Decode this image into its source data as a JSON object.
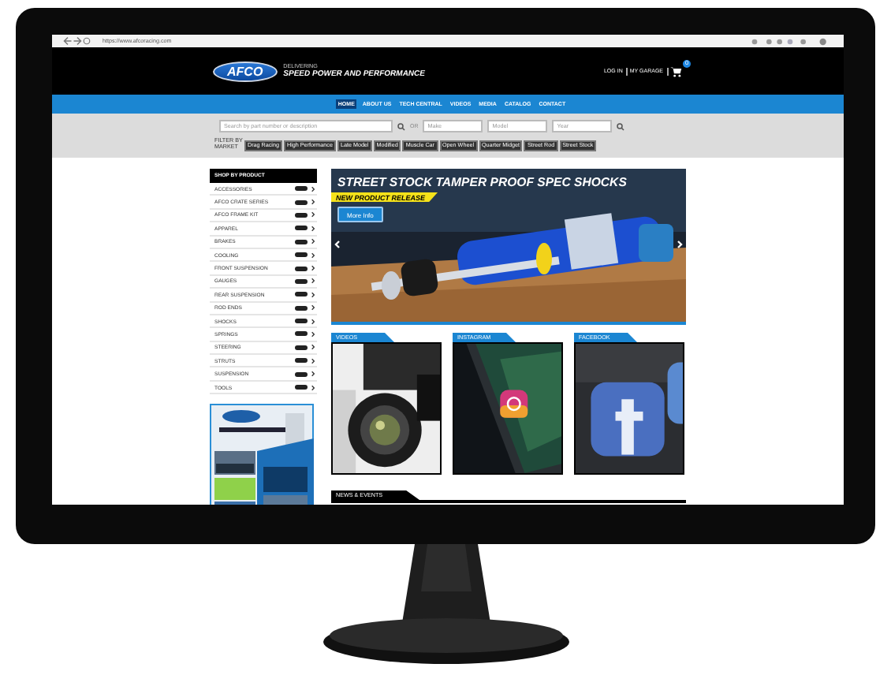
{
  "browser": {
    "url": "https://www.afcoracing.com"
  },
  "header": {
    "logo": "AFCO",
    "tagline_small": "DELIVERING",
    "tagline": "SPEED POWER AND PERFORMANCE",
    "links": [
      "LOG IN",
      "MY GARAGE"
    ],
    "cart_count": "0"
  },
  "nav": [
    {
      "label": "HOME",
      "selected": true
    },
    {
      "label": "ABOUT US",
      "selected": false
    },
    {
      "label": "TECH CENTRAL",
      "selected": false
    },
    {
      "label": "VIDEOS",
      "selected": false
    },
    {
      "label": "MEDIA",
      "selected": false
    },
    {
      "label": "CATALOG",
      "selected": false
    },
    {
      "label": "CONTACT",
      "selected": false
    }
  ],
  "search": {
    "placeholder": "Search by part number or description",
    "or": "OR",
    "make": {
      "placeholder": "Make"
    },
    "model": {
      "placeholder": "Model"
    },
    "year": {
      "placeholder": "Year"
    }
  },
  "filter": {
    "label": "FILTER BY MARKET",
    "tags": [
      "Drag Racing",
      "High Performance",
      "Late Model",
      "Modified",
      "Muscle Car",
      "Open Wheel",
      "Quarter Midget",
      "Street Rod",
      "Street Stock"
    ]
  },
  "sidebar": {
    "title": "SHOP BY PRODUCT",
    "items": [
      "ACCESSORIES",
      "AFCO CRATE SERIES",
      "AFCO FRAME KIT",
      "APPAREL",
      "BRAKES",
      "COOLING",
      "FRONT SUSPENSION",
      "GAUGES",
      "REAR SUSPENSION",
      "ROD ENDS",
      "SHOCKS",
      "SPRINGS",
      "STEERING",
      "STRUTS",
      "SUSPENSION",
      "TOOLS"
    ]
  },
  "banner": {
    "title": "STREET STOCK TAMPER PROOF SPEC SHOCKS",
    "ribbon": "NEW PRODUCT RELEASE",
    "button": "More Info"
  },
  "social": [
    {
      "label": "VIDEOS",
      "kind": "camera"
    },
    {
      "label": "INSTAGRAM",
      "kind": "phone"
    },
    {
      "label": "FACEBOOK",
      "kind": "app"
    }
  ],
  "news": {
    "title": "NEWS & EVENTS"
  }
}
